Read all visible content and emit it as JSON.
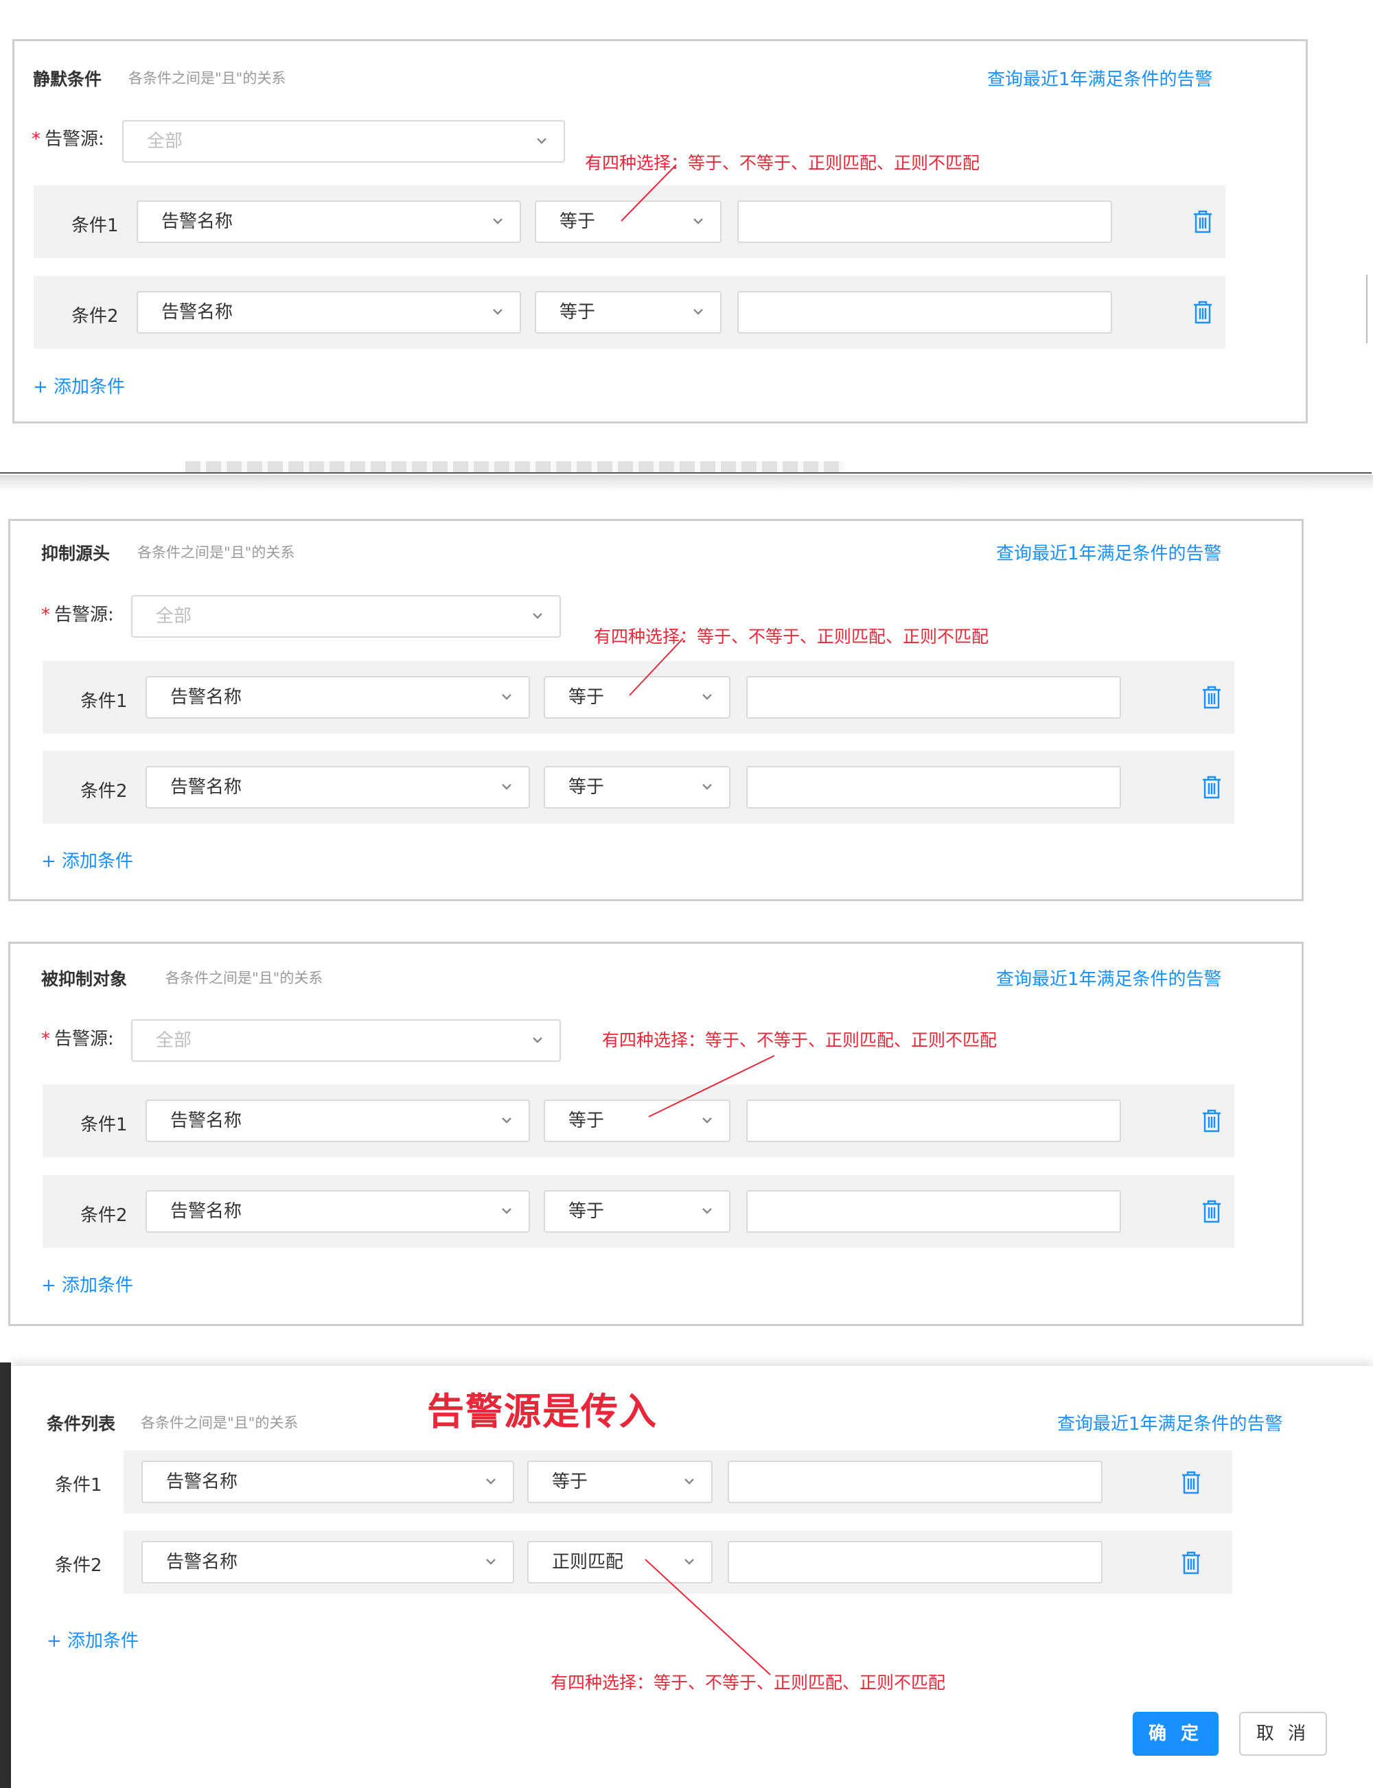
{
  "annotation_text": "有四种选择：等于、不等于、正则匹配、正则不匹配",
  "section_silence": {
    "title": "静默条件",
    "subtitle": "各条件之间是\"且\"的关系",
    "query_link": "查询最近1年满足条件的告警",
    "source_label": "告警源:",
    "source_value": "全部",
    "conditions": [
      {
        "label": "条件1",
        "field": "告警名称",
        "operator": "等于",
        "value": ""
      },
      {
        "label": "条件2",
        "field": "告警名称",
        "operator": "等于",
        "value": ""
      }
    ],
    "add_label": "+ 添加条件"
  },
  "section_suppress_source": {
    "title": "抑制源头",
    "subtitle": "各条件之间是\"且\"的关系",
    "query_link": "查询最近1年满足条件的告警",
    "source_label": "告警源:",
    "source_value": "全部",
    "conditions": [
      {
        "label": "条件1",
        "field": "告警名称",
        "operator": "等于",
        "value": ""
      },
      {
        "label": "条件2",
        "field": "告警名称",
        "operator": "等于",
        "value": ""
      }
    ],
    "add_label": "+ 添加条件"
  },
  "section_suppressed_target": {
    "title": "被抑制对象",
    "subtitle": "各条件之间是\"且\"的关系",
    "query_link": "查询最近1年满足条件的告警",
    "source_label": "告警源:",
    "source_value": "全部",
    "conditions": [
      {
        "label": "条件1",
        "field": "告警名称",
        "operator": "等于",
        "value": ""
      },
      {
        "label": "条件2",
        "field": "告警名称",
        "operator": "等于",
        "value": ""
      }
    ],
    "add_label": "+ 添加条件"
  },
  "section_condition_list": {
    "title": "条件列表",
    "subtitle": "各条件之间是\"且\"的关系",
    "big_note": "告警源是传入",
    "query_link": "查询最近1年满足条件的告警",
    "conditions": [
      {
        "label": "条件1",
        "field": "告警名称",
        "operator": "等于",
        "value": ""
      },
      {
        "label": "条件2",
        "field": "告警名称",
        "operator": "正则匹配",
        "value": ""
      }
    ],
    "add_label": "+ 添加条件"
  },
  "footer": {
    "confirm_label": "确 定",
    "cancel_label": "取 消"
  },
  "colors": {
    "link": "#1890ff",
    "annotation": "#e8283a",
    "row_bg": "#f2f2f2",
    "primary_button": "#1890ff"
  },
  "icons": {
    "chevron": "chevron-down-icon",
    "delete": "trash-icon"
  }
}
